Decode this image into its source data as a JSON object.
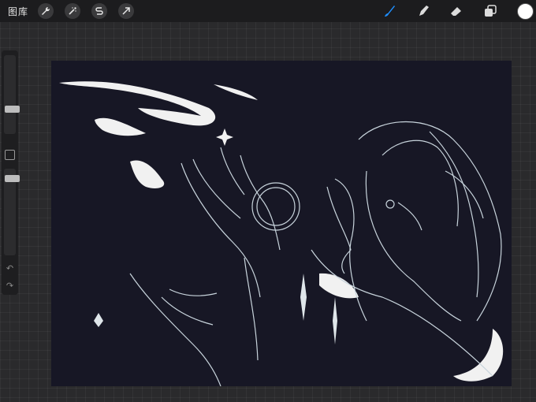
{
  "topbar": {
    "gallery_label": "图库",
    "left_tools": [
      {
        "name": "actions",
        "icon": "wrench-icon"
      },
      {
        "name": "adjustments",
        "icon": "magic-wand-icon"
      },
      {
        "name": "selection",
        "icon": "selection-s-icon"
      },
      {
        "name": "transform",
        "icon": "arrow-cursor-icon"
      }
    ],
    "right_tools": [
      {
        "name": "brush",
        "icon": "brush-icon",
        "active": true
      },
      {
        "name": "smudge",
        "icon": "smudge-finger-icon"
      },
      {
        "name": "eraser",
        "icon": "eraser-icon"
      },
      {
        "name": "layers",
        "icon": "layers-icon"
      }
    ],
    "current_color": "#ffffff",
    "active_color": "#1e8fff"
  },
  "sidebar": {
    "brush_size": 0.35,
    "opacity": 0.85,
    "modifier_icon": "square-modifier-icon",
    "undo_icon": "undo-icon",
    "redo_icon": "redo-icon"
  },
  "canvas": {
    "background": "#171725",
    "artwork": "line-art-illustration"
  }
}
